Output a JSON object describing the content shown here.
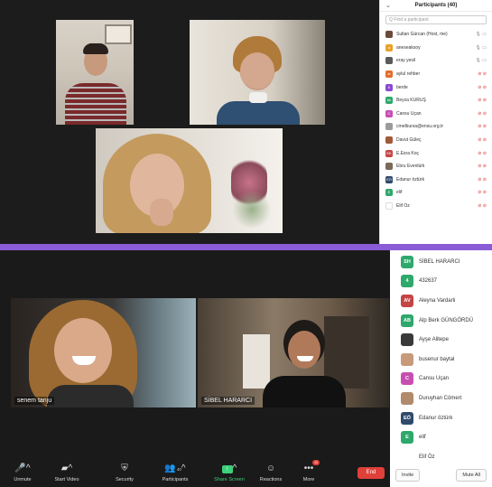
{
  "top_panel": {
    "title": "Participants (40)",
    "search_placeholder": "Q Find a participant",
    "participants": [
      {
        "initials": "",
        "name": "Sultan Gürcan (Host, me)",
        "color": "#6b4a3a",
        "status": "mic video"
      },
      {
        "initials": "a",
        "name": "aneseaksoy",
        "color": "#e8a22a",
        "status": "mic video"
      },
      {
        "initials": "",
        "name": "eray yesil",
        "color": "#5a5a5a",
        "status": "mic video"
      },
      {
        "initials": "ar",
        "name": "aylul rehber",
        "color": "#e26b2a",
        "status": "muted"
      },
      {
        "initials": "b",
        "name": "berde",
        "color": "#8a4bd1",
        "status": "muted"
      },
      {
        "initials": "bk",
        "name": "Beyza KURUŞ",
        "color": "#2ea86b",
        "status": "muted"
      },
      {
        "initials": "C",
        "name": "Cansu Uçan",
        "color": "#c74fb0",
        "status": "muted"
      },
      {
        "initials": "",
        "name": "cmelbursa@ensu.org.tr",
        "color": "#9b9b9b",
        "status": "muted"
      },
      {
        "initials": "",
        "name": "Davut Güleç",
        "color": "#a05a3a",
        "status": "muted"
      },
      {
        "initials": "EK",
        "name": "E.Esra Koç",
        "color": "#c44545",
        "status": "muted"
      },
      {
        "initials": "",
        "name": "Ebru Evenlürk",
        "color": "#7a6a5a",
        "status": "muted"
      },
      {
        "initials": "EÖ",
        "name": "Edanur öztürk",
        "color": "#2f4a6b",
        "status": "muted"
      },
      {
        "initials": "E",
        "name": "elif",
        "color": "#2ea86b",
        "status": "muted"
      },
      {
        "initials": "",
        "name": "Elif Öz",
        "color": "#ffffff",
        "status": "muted"
      }
    ]
  },
  "bottom_panel": {
    "participants": [
      {
        "initials": "SH",
        "name": "SİBEL HARARCI",
        "color": "#2ea86b"
      },
      {
        "initials": "4",
        "name": "432637",
        "color": "#2ea86b"
      },
      {
        "initials": "AV",
        "name": "Aleyna Vardarlı",
        "color": "#c44545"
      },
      {
        "initials": "AB",
        "name": "Alp Berk GÜNGÖRDÜ",
        "color": "#2ea86b"
      },
      {
        "initials": "",
        "name": "Ayşe Alitepe",
        "color": "#3a3a3a"
      },
      {
        "initials": "",
        "name": "busenur baytal",
        "color": "#c79a7a"
      },
      {
        "initials": "C",
        "name": "Cansu Uçan",
        "color": "#c74fb0"
      },
      {
        "initials": "",
        "name": "Duruyhan Cömert",
        "color": "#b08a6a"
      },
      {
        "initials": "EÖ",
        "name": "Edanur öztürk",
        "color": "#2f4a6b"
      },
      {
        "initials": "E",
        "name": "elif",
        "color": "#2ea86b"
      },
      {
        "initials": "",
        "name": "Elif Öz",
        "color": "#ffffff"
      }
    ],
    "invite_label": "Invite",
    "mute_all_label": "Mute All"
  },
  "video_labels": {
    "senem": "senem tanju",
    "sibel": "SİBEL HARARCI"
  },
  "toolbar": {
    "unmute": "Unmute",
    "start_video": "Start Video",
    "security": "Security",
    "participants": "Participants",
    "participants_count": "40",
    "share_screen": "Share Screen",
    "reactions": "Reactions",
    "more": "More",
    "more_badge": "11",
    "end": "End"
  }
}
